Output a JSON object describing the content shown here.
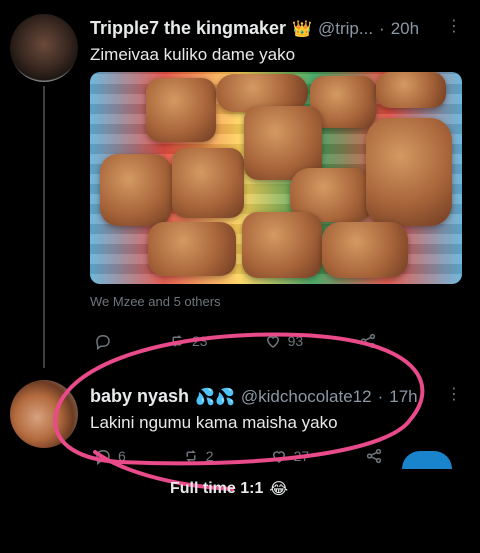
{
  "tweet1": {
    "name": "Tripple7 the kingmaker",
    "name_emoji": "👑",
    "handle": "@trip...",
    "dot": "·",
    "time": "20h",
    "text": "Zimeivaa kuliko dame yako",
    "liked_by": "We Mzee and 5 others",
    "retweets": "23",
    "likes": "93",
    "icons": [
      "reply-icon",
      "retweet-icon",
      "heart-icon",
      "share-icon"
    ]
  },
  "tweet2": {
    "name": "baby nyash",
    "name_emoji": "💦💦",
    "handle": "@kidchocolate12",
    "dot": "·",
    "time": "17h",
    "text": "Lakini ngumu kama maisha yako",
    "replies": "6",
    "retweets": "2",
    "likes": "27",
    "icons": [
      "reply-icon",
      "retweet-icon",
      "heart-icon",
      "share-icon"
    ]
  },
  "caption": {
    "text": "Full time 1:1",
    "emoji": "😂"
  },
  "colors": {
    "background": "#000000",
    "text": "#e7e9ea",
    "muted": "#71767b",
    "annotation": "#e84a8a",
    "accent": "#1d9bf0"
  }
}
